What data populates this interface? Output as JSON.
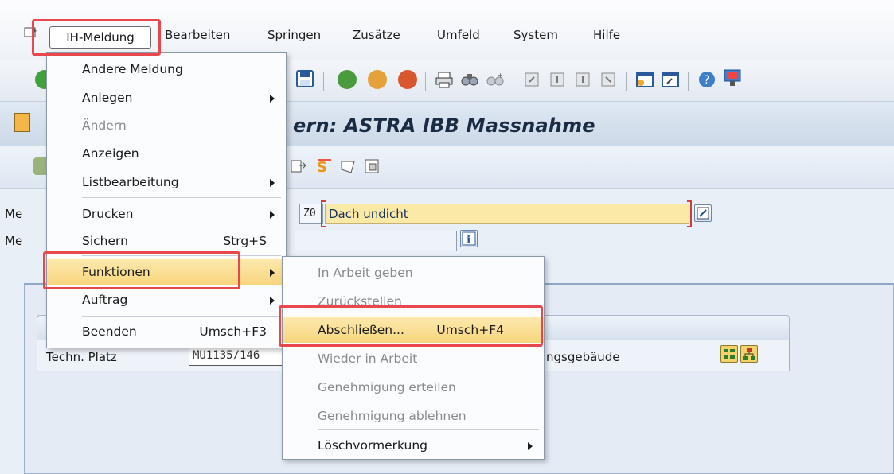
{
  "menubar": {
    "items": [
      {
        "label": "IH-Meldung"
      },
      {
        "label": "Bearbeiten"
      },
      {
        "label": "Springen"
      },
      {
        "label": "Zusätze"
      },
      {
        "label": "Umfeld"
      },
      {
        "label": "System"
      },
      {
        "label": "Hilfe"
      }
    ]
  },
  "title": {
    "text": "ern: ASTRA IBB Massnahme"
  },
  "fields": {
    "meldung_label_partial": "Me",
    "meldung2_label_partial": "Me",
    "code": "Z0",
    "description": "Dach undicht",
    "techn_platz_label": "Techn. Platz",
    "techn_platz_value": "MU1135/146",
    "techn_platz_desc_partial": "ngsgebäude"
  },
  "menu_ih_meldung": [
    {
      "label": "Andere Meldung",
      "disabled": false
    },
    {
      "label": "Anlegen",
      "disabled": false,
      "submenu": true
    },
    {
      "label": "Ändern",
      "disabled": true
    },
    {
      "label": "Anzeigen",
      "disabled": false
    },
    {
      "label": "Listbearbeitung",
      "disabled": false,
      "submenu": true
    },
    {
      "label": "Drucken",
      "disabled": false,
      "submenu": true
    },
    {
      "label": "Sichern",
      "disabled": false,
      "accel": "Strg+S"
    },
    {
      "label": "Funktionen",
      "disabled": false,
      "submenu": true,
      "highlighted": true
    },
    {
      "label": "Auftrag",
      "disabled": false,
      "submenu": true
    },
    {
      "label": "Beenden",
      "disabled": false,
      "accel": "Umsch+F3"
    }
  ],
  "menu_funktionen": [
    {
      "label": "In Arbeit geben",
      "disabled": true
    },
    {
      "label": "Zurückstellen",
      "disabled": true
    },
    {
      "label": "Abschließen...",
      "disabled": false,
      "accel": "Umsch+F4",
      "highlighted": true
    },
    {
      "label": "Wieder in Arbeit",
      "disabled": true
    },
    {
      "label": "Genehmigung erteilen",
      "disabled": true
    },
    {
      "label": "Genehmigung ablehnen",
      "disabled": true
    },
    {
      "label": "Löschvormerkung",
      "disabled": false,
      "submenu": true
    }
  ],
  "colors": {
    "highlight": "#f9dc8b",
    "annotation_red": "#e8484d",
    "required_field": "#fbe9a8"
  }
}
